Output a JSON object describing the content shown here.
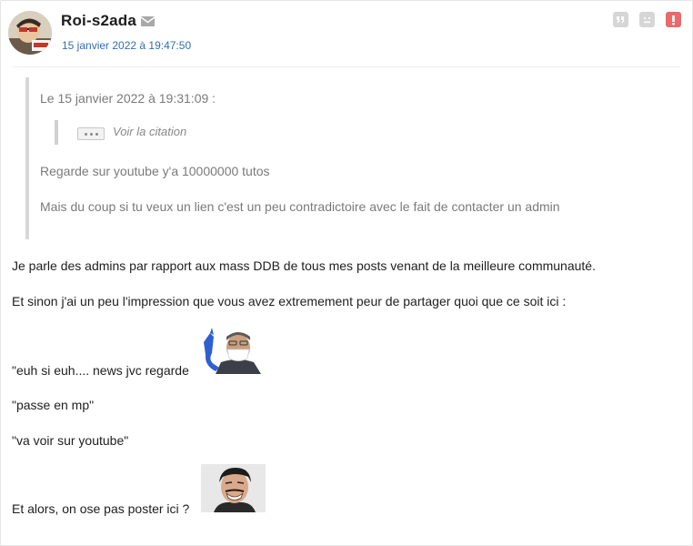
{
  "post": {
    "author": "Roi-s2ada",
    "date": "15 janvier 2022 à 19:47:50"
  },
  "icons": {
    "mail": "envelope-icon",
    "quote": "quote-icon",
    "sad": "sad-face-icon",
    "alert": "alert-icon"
  },
  "colors": {
    "date_link": "#2f6fb4",
    "alert": "#e86a6a",
    "action_grey": "#d6d6d6"
  },
  "quote": {
    "header": "Le 15 janvier 2022 à 19:31:09 :",
    "nested_label": "Voir la citation",
    "lines": [
      "Regarde sur youtube y'a 10000000 tutos",
      "Mais du coup si tu veux un lien c'est un peu contradictoire avec le fait de contacter un admin"
    ]
  },
  "body": {
    "lines": [
      "Je parle des admins par rapport aux mass DDB de tous mes posts venant de la meilleure communauté.",
      "Et sinon j'ai un peu l'impression que vous avez extremement peur de partager quoi que ce soit ici :",
      "\"euh si euh.... news jvc regarde",
      "\"passe en mp\"",
      "\"va voir sur youtube\"",
      "Et alors, on ose pas poster ici ?"
    ]
  }
}
